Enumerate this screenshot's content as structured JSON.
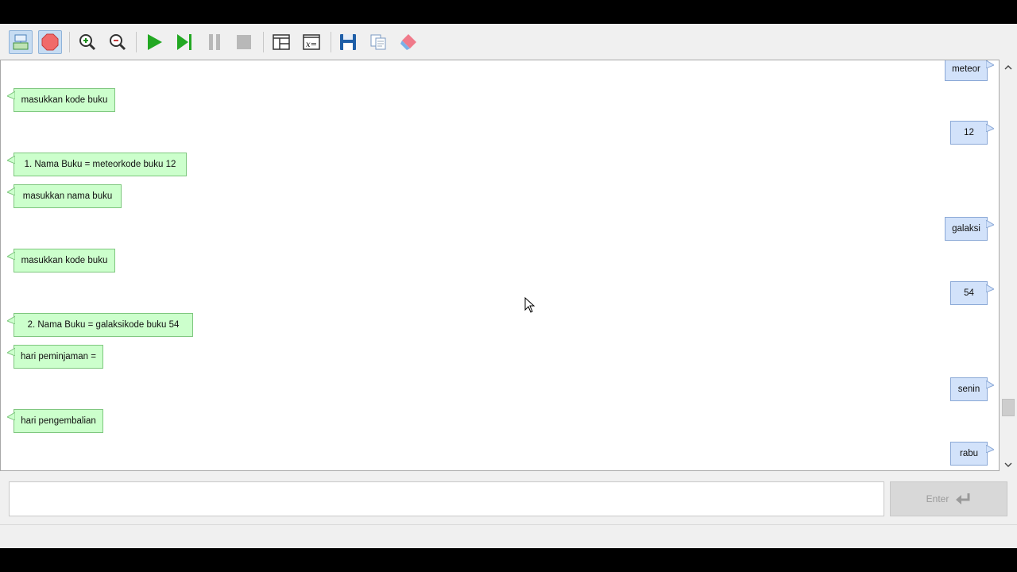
{
  "toolbar": {
    "buttons": [
      {
        "id": "edit-mode",
        "icon": "flowchart-edit-icon",
        "active": true
      },
      {
        "id": "stop-record",
        "icon": "record-stop-icon",
        "active": true
      },
      {
        "id": "zoom-in",
        "icon": "zoom-in-icon"
      },
      {
        "id": "zoom-out",
        "icon": "zoom-out-icon"
      },
      {
        "id": "run",
        "icon": "play-icon"
      },
      {
        "id": "step",
        "icon": "step-forward-icon"
      },
      {
        "id": "pause",
        "icon": "pause-icon"
      },
      {
        "id": "stop",
        "icon": "stop-icon"
      },
      {
        "id": "layout",
        "icon": "window-layout-icon"
      },
      {
        "id": "variables",
        "icon": "variables-icon"
      },
      {
        "id": "save",
        "icon": "save-icon"
      },
      {
        "id": "copy",
        "icon": "copy-icon"
      },
      {
        "id": "clear",
        "icon": "eraser-icon"
      }
    ]
  },
  "colors": {
    "output_bubble": "#ccffcc",
    "input_bubble": "#d2e2fa",
    "accent": "#1a8f1a"
  },
  "console": {
    "messages": [
      {
        "side": "in",
        "text": "meteor"
      },
      {
        "side": "out",
        "text": "masukkan kode buku"
      },
      {
        "side": "in",
        "text": "12"
      },
      {
        "side": "out",
        "text": "1. Nama Buku = meteorkode buku 12"
      },
      {
        "side": "out",
        "text": "masukkan nama buku"
      },
      {
        "side": "in",
        "text": "galaksi"
      },
      {
        "side": "out",
        "text": "masukkan kode buku"
      },
      {
        "side": "in",
        "text": "54"
      },
      {
        "side": "out",
        "text": "2. Nama Buku = galaksikode buku 54"
      },
      {
        "side": "out",
        "text": "hari peminjaman ="
      },
      {
        "side": "in",
        "text": "senin"
      },
      {
        "side": "out",
        "text": "hari pengembalian"
      },
      {
        "side": "in",
        "text": "rabu"
      }
    ]
  },
  "input": {
    "value": "",
    "placeholder": "",
    "enter_label": "Enter"
  }
}
